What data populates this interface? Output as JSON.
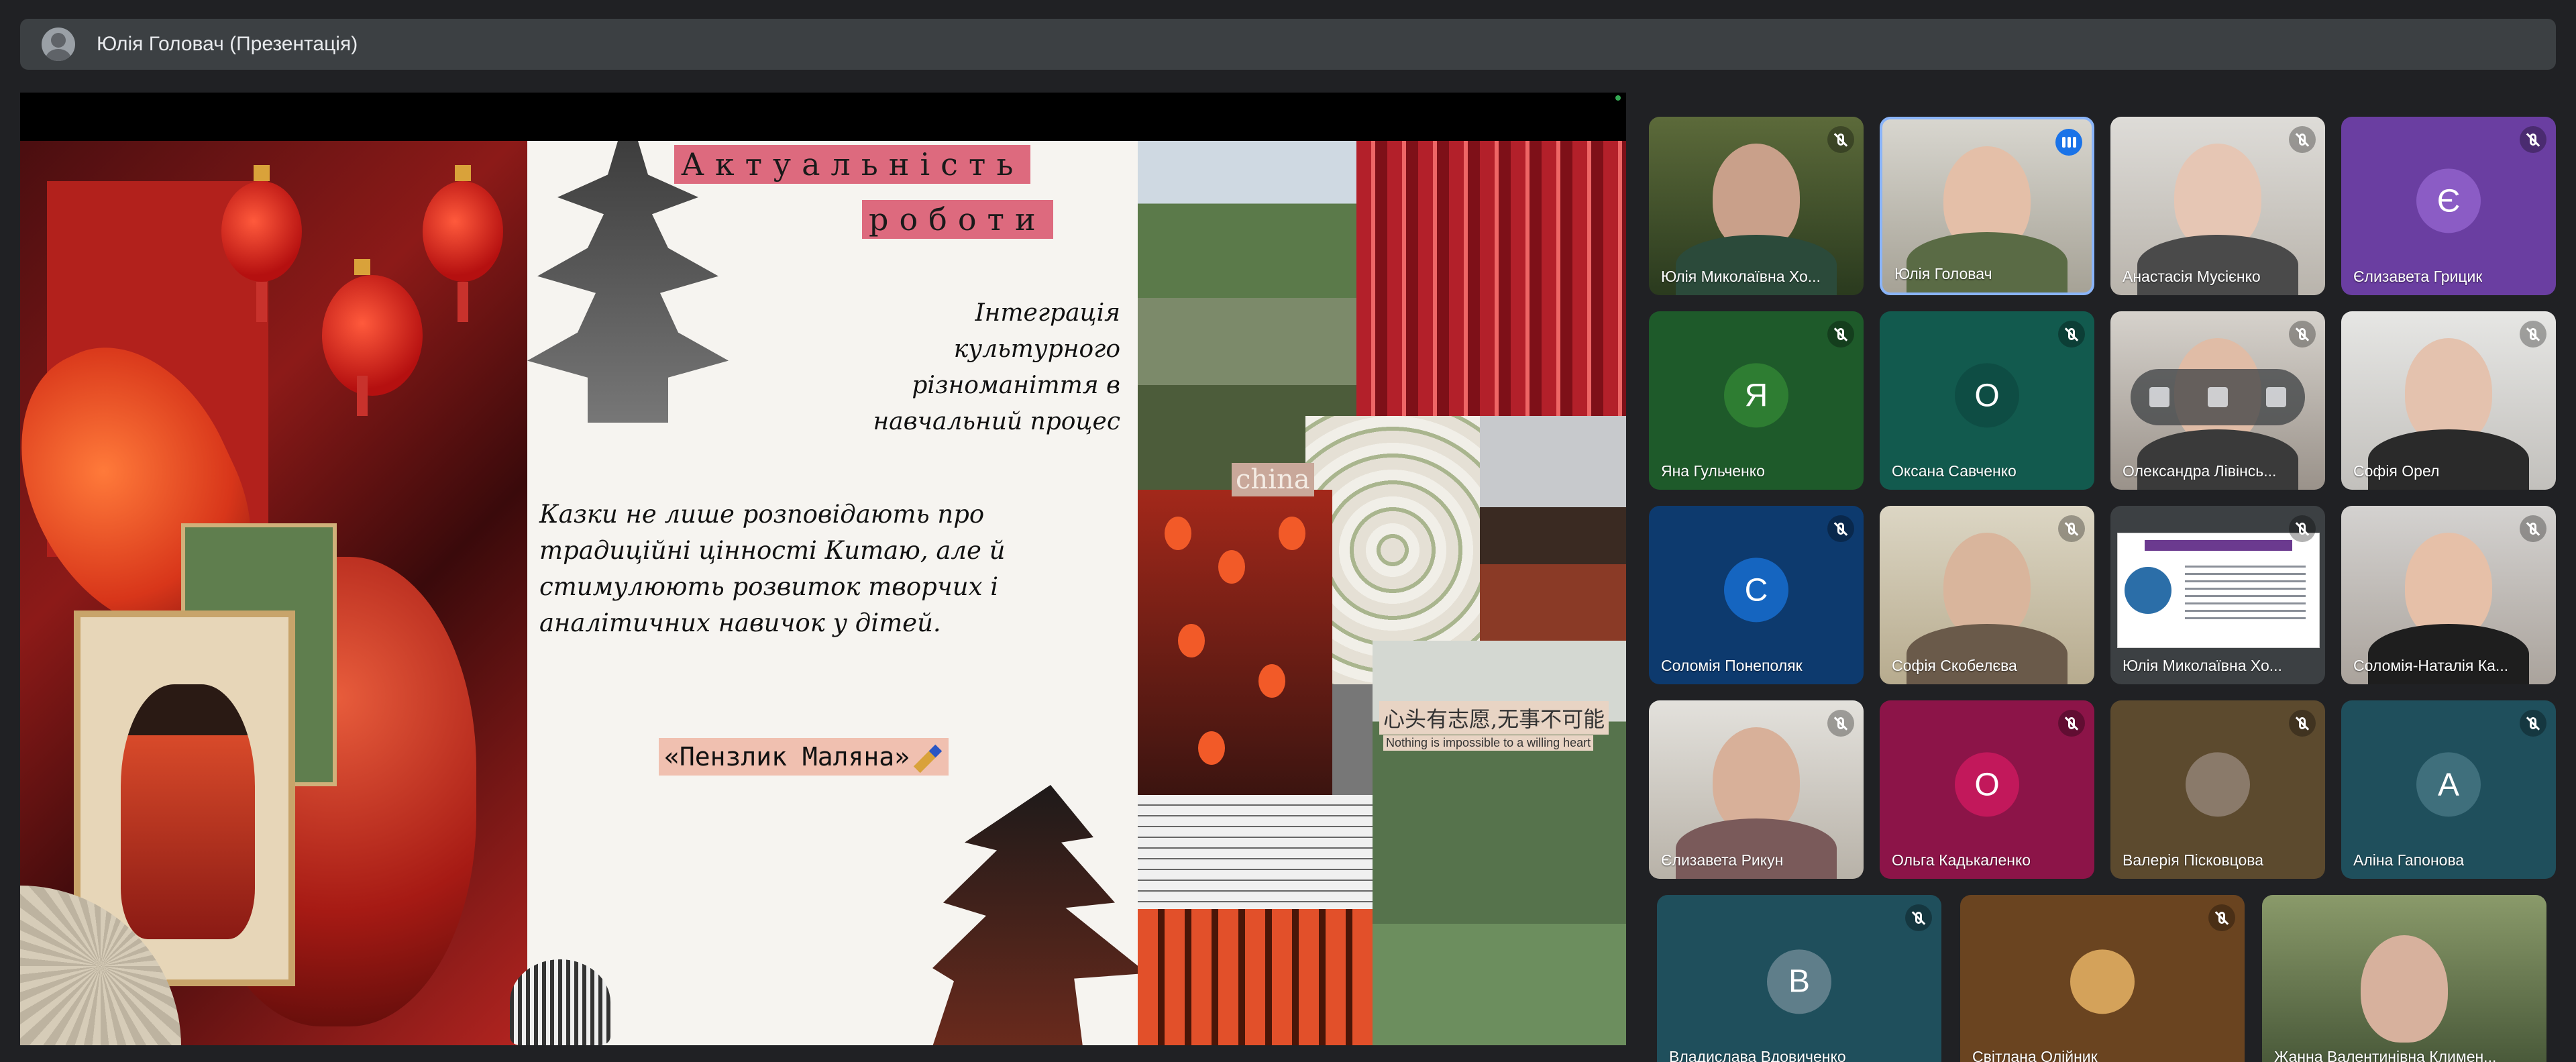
{
  "header": {
    "presenter_title": "Юлія Головач (Презентація)"
  },
  "slide": {
    "title_line1": "Актуальність",
    "title_line2": "роботи",
    "subtitle": "Інтеграція культурного різноманіття в навчальний процес",
    "body": "Казки не лише розповідають про традиційні цінності Китаю, але й стимулюють розвиток творчих і аналітичних навичок у дітей.",
    "project_name": "«Пензлик Маляна»",
    "collage_china": "china",
    "collage_chinese_text": "心头有志愿,无事不可能",
    "collage_english_text": "Nothing is impossible to a willing heart"
  },
  "participants": [
    {
      "name": "Юлія Миколаївна Хо...",
      "status": "muted"
    },
    {
      "name": "Юлія Головач",
      "status": "speaking"
    },
    {
      "name": "Анастасія Мусієнко",
      "status": "muted"
    },
    {
      "name": "Єлизавета Грицик",
      "status": "muted",
      "initial": "Є"
    },
    {
      "name": "Яна Гульченко",
      "status": "muted",
      "initial": "Я"
    },
    {
      "name": "Оксана Савченко",
      "status": "muted",
      "initial": "О"
    },
    {
      "name": "Олександра Лівінсь...",
      "status": "muted"
    },
    {
      "name": "Софія Орел",
      "status": "muted"
    },
    {
      "name": "Соломія Понеполяк",
      "status": "muted",
      "initial": "С"
    },
    {
      "name": "Софія Скобелєва",
      "status": "muted"
    },
    {
      "name": "Юлія Миколаївна Хо...",
      "status": "muted"
    },
    {
      "name": "Соломія-Наталія Ка...",
      "status": "muted"
    },
    {
      "name": "Єлизавета Рикун",
      "status": "muted"
    },
    {
      "name": "Ольга Кадькаленко",
      "status": "muted",
      "initial": "О"
    },
    {
      "name": "Валерія Пісковцова",
      "status": "muted"
    },
    {
      "name": "Аліна Гапонова",
      "status": "muted",
      "initial": "А"
    },
    {
      "name": "Владислава Вдовиченко",
      "status": "muted",
      "initial": "В"
    },
    {
      "name": "Світлана Олійник",
      "status": "muted"
    },
    {
      "name": "Жанна Валентинівна Климен...",
      "status": "unmuted"
    }
  ],
  "colors": {
    "accent": "#1a73e8",
    "background": "#202124",
    "title_box": "#dd6a7e"
  }
}
